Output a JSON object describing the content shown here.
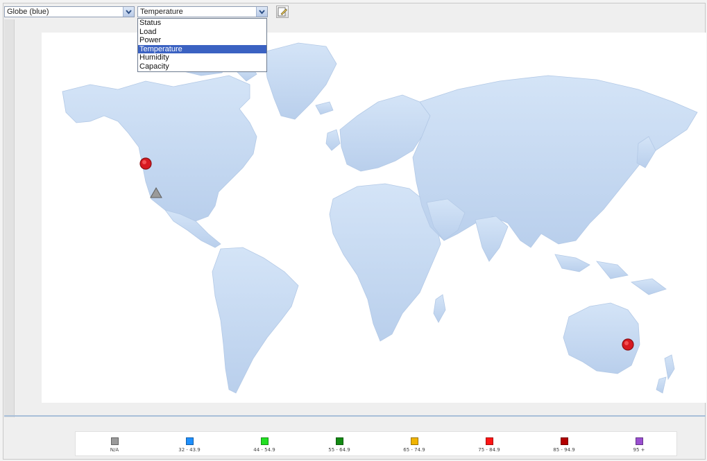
{
  "toolbar": {
    "map_select_value": "Globe (blue)",
    "metric_select_value": "Temperature"
  },
  "metric_dropdown": {
    "options": [
      "Status",
      "Load",
      "Power",
      "Temperature",
      "Humidity",
      "Capacity"
    ],
    "selected": "Temperature"
  },
  "map": {
    "land_color": "#c9dcf3",
    "markers": [
      {
        "shape": "circle",
        "color": "#d71920",
        "location": "US west coast (Pacific Northwest)"
      },
      {
        "shape": "triangle",
        "color": "#9a9a9a",
        "location": "US west coast (California)"
      },
      {
        "shape": "circle",
        "color": "#d71920",
        "location": "Eastern Australia"
      }
    ]
  },
  "legend": {
    "items": [
      {
        "label": "N/A",
        "color": "#9a9a9a"
      },
      {
        "label": "32 - 43.9",
        "color": "#1e90ff"
      },
      {
        "label": "44 - 54.9",
        "color": "#22e022"
      },
      {
        "label": "55 - 64.9",
        "color": "#138a13"
      },
      {
        "label": "65 - 74.9",
        "color": "#f0b400"
      },
      {
        "label": "75 - 84.9",
        "color": "#ff1515"
      },
      {
        "label": "85 - 94.9",
        "color": "#b30000"
      },
      {
        "label": "95 +",
        "color": "#9a4fd0"
      }
    ]
  }
}
